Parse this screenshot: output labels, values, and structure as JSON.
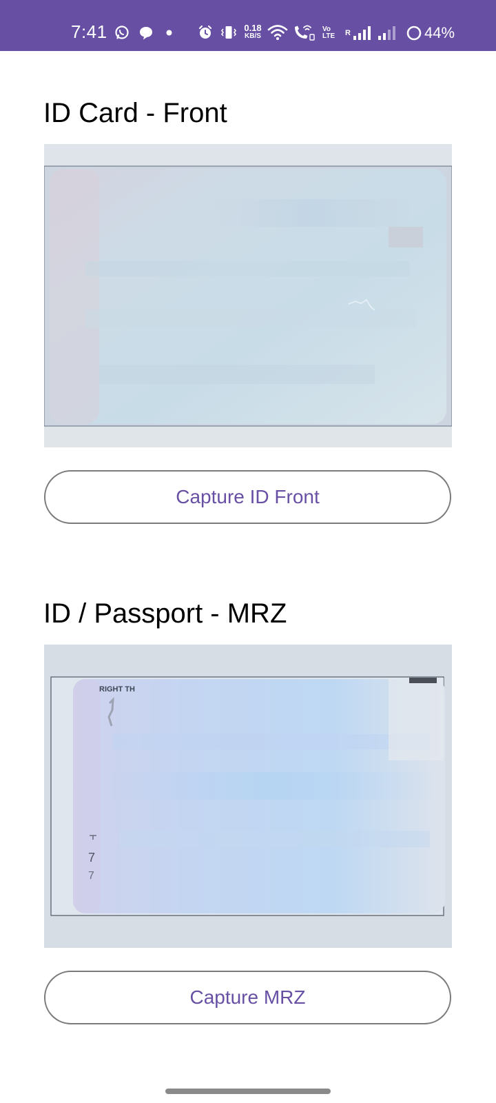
{
  "status_bar": {
    "time": "7:41",
    "net_speed_value": "0.18",
    "net_speed_unit": "KB/S",
    "volte_top": "Vo",
    "volte_bottom": "LTE",
    "roaming_label": "R",
    "battery_percent": "44%",
    "icons": [
      "whatsapp-icon",
      "chat-bubble-icon",
      "dot-icon",
      "alarm-icon",
      "vibrate-icon",
      "wifi-icon",
      "wifi-calling-icon",
      "signal-icon",
      "signal-weak-icon",
      "battery-ring-icon"
    ]
  },
  "front_section": {
    "title": "ID Card - Front",
    "button_label": "Capture ID Front"
  },
  "mrz_section": {
    "title": "ID / Passport - MRZ",
    "card_text": "RIGHT TH",
    "digit_1": "7",
    "digit_2": "7",
    "button_label": "Capture MRZ"
  },
  "colors": {
    "accent": "#6750a4",
    "button_border": "#7a7a7a",
    "preview_background": "#d5dce4"
  }
}
